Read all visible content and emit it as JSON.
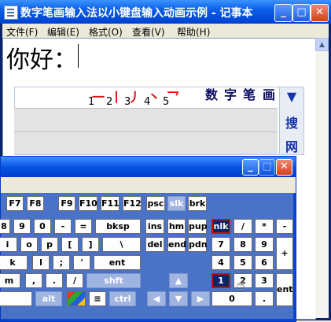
{
  "notepad": {
    "title": "数字笔画输入法以小键盘输入动画示例 - 记事本",
    "menus": [
      "文件(F)",
      "编辑(E)",
      "格式(O)",
      "查看(V)",
      "帮助(H)"
    ],
    "content": "你好："
  },
  "ime": {
    "strokes": [
      {
        "glyph": "一",
        "num": "1"
      },
      {
        "glyph": "丨",
        "num": "2"
      },
      {
        "glyph": "丿",
        "num": "3"
      },
      {
        "glyph": "丶",
        "num": "4"
      },
      {
        "glyph": "乛",
        "num": "5"
      }
    ],
    "title_chars": [
      "数",
      "字",
      "笔",
      "画"
    ],
    "side_arrow": "▼",
    "side_items": [
      "搜",
      "网"
    ]
  },
  "osk": {
    "rows": [
      [
        "F7",
        "F8",
        "F9",
        "F10",
        "F11",
        "F12",
        "psc",
        "slk",
        "brk"
      ],
      [
        "8",
        "9",
        "0",
        "-",
        "=",
        "bksp",
        "ins",
        "hm",
        "pup",
        "nlk",
        "/",
        "*",
        "-"
      ],
      [
        "i",
        "o",
        "p",
        "[",
        "]",
        "\\",
        "del",
        "end",
        "pdn",
        "7",
        "8",
        "9",
        "+"
      ],
      [
        "k",
        "l",
        ";",
        "'",
        "ent",
        "4",
        "5",
        "6"
      ],
      [
        "m",
        ",",
        ".",
        "/",
        "shft",
        "1",
        "2",
        "3",
        "ent"
      ],
      [
        "alt",
        "ctrl",
        "0",
        "."
      ]
    ]
  }
}
